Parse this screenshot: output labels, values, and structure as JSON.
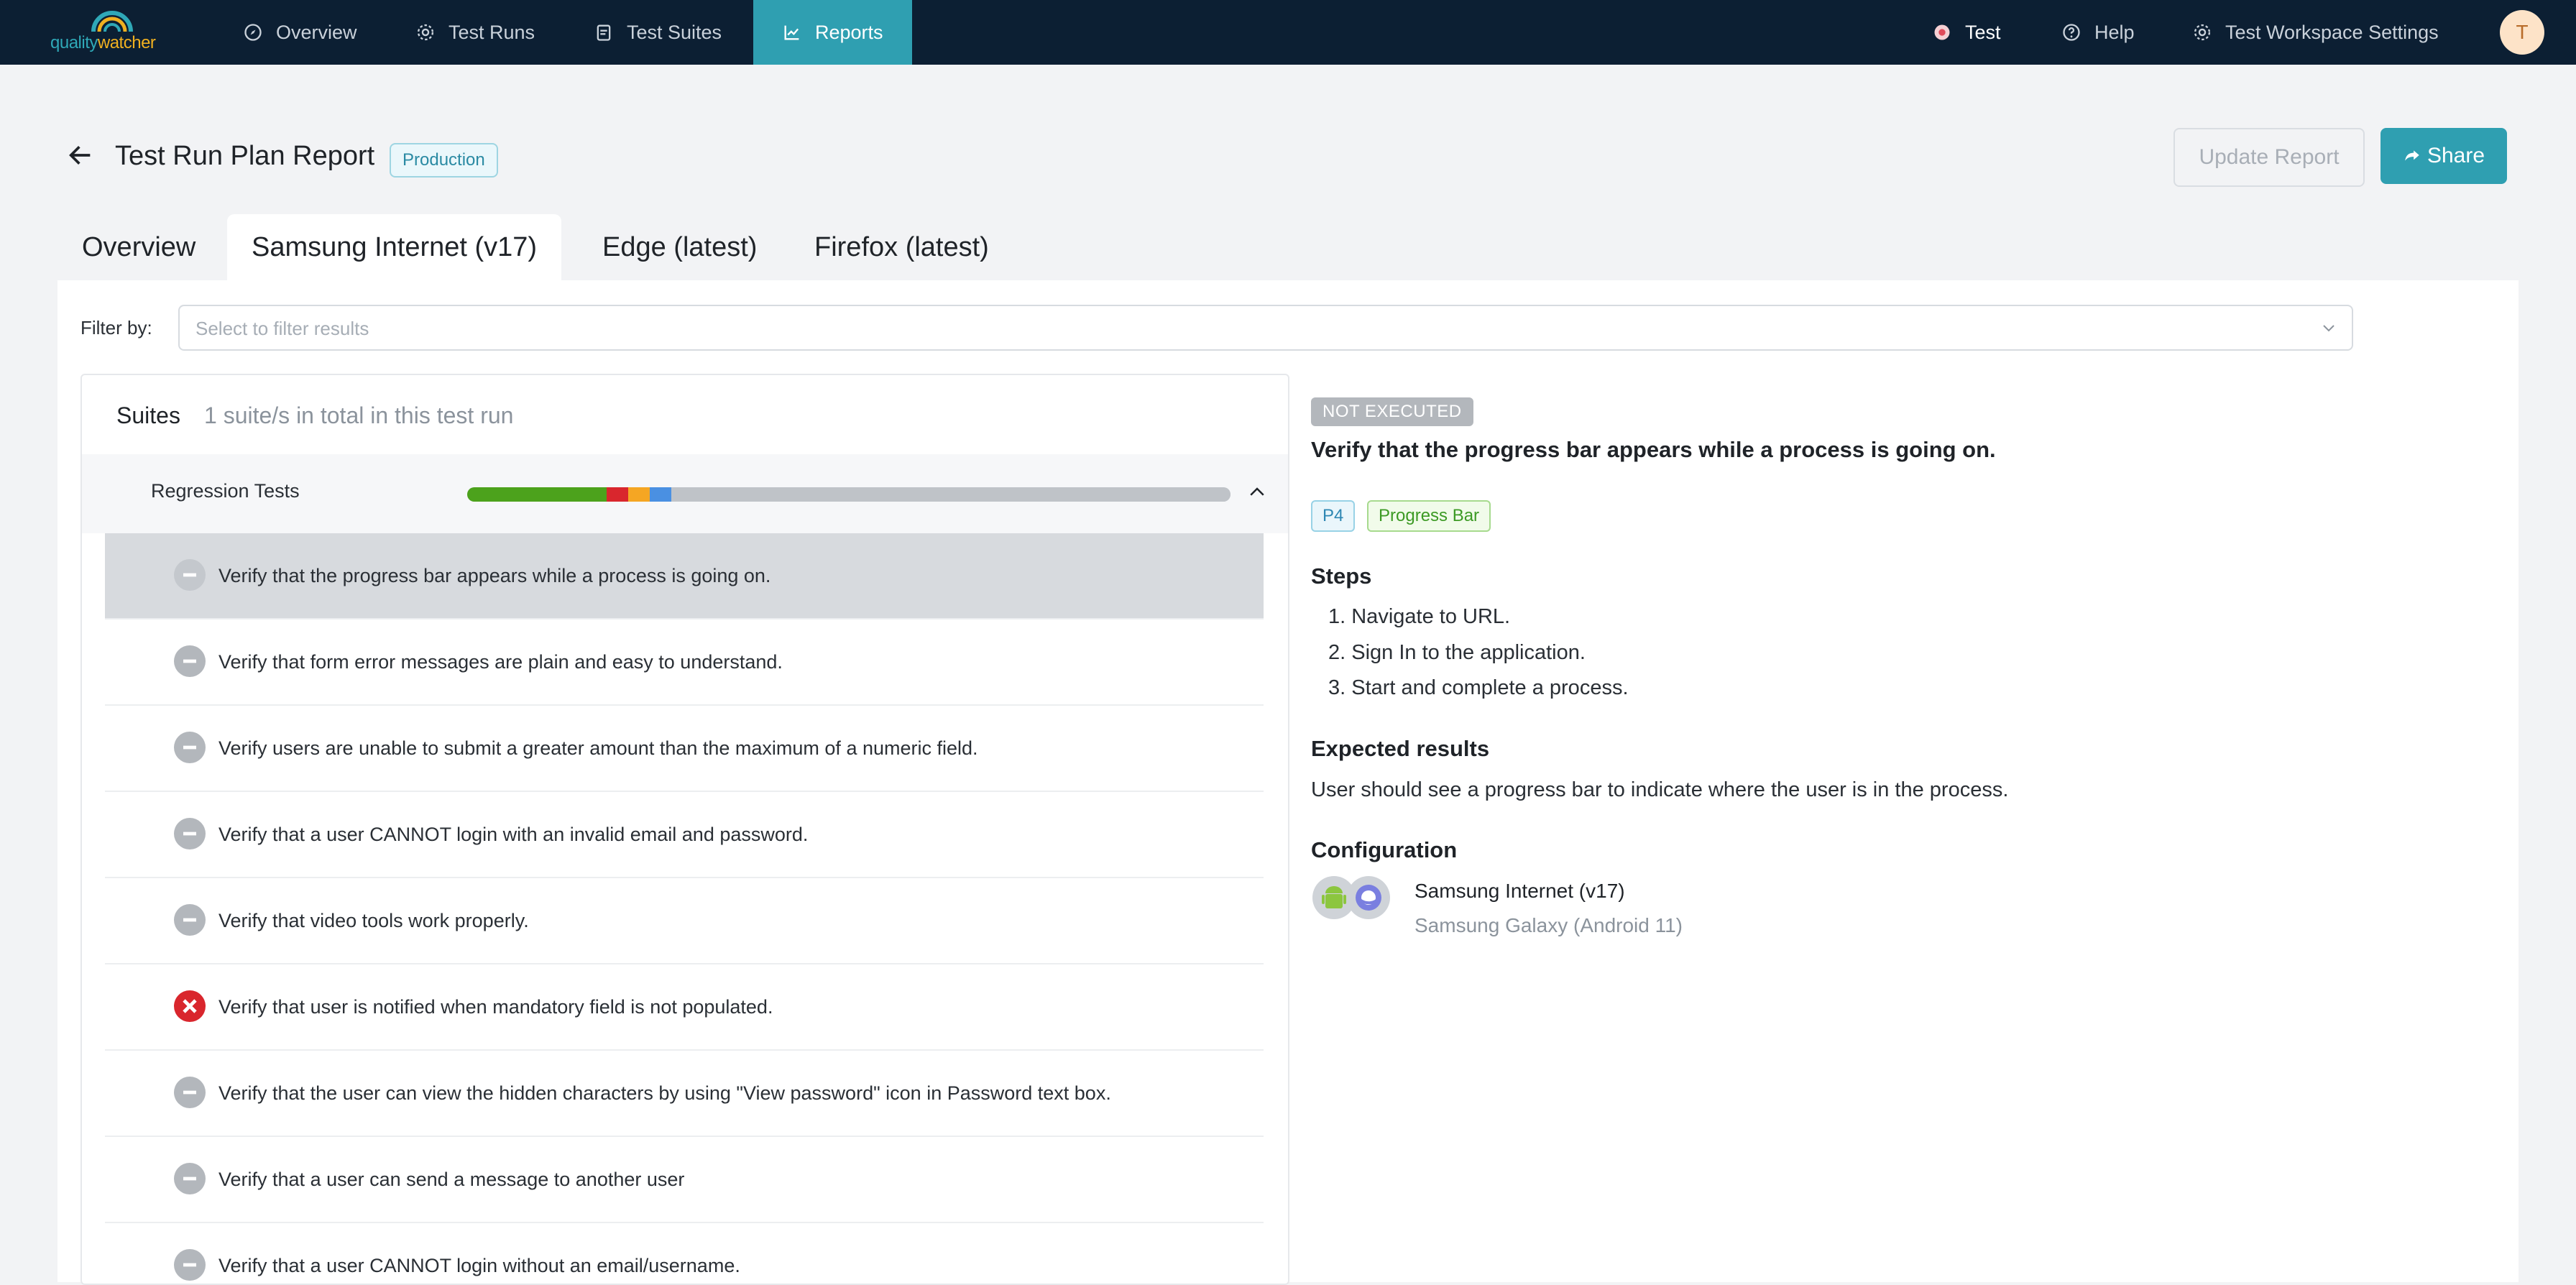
{
  "nav": {
    "logo": {
      "part1": "quality",
      "part2": "watcher"
    },
    "items": [
      {
        "label": "Overview",
        "icon": "compass-icon"
      },
      {
        "label": "Test Runs",
        "icon": "gear-icon"
      },
      {
        "label": "Test Suites",
        "icon": "clipboard-icon"
      },
      {
        "label": "Reports",
        "icon": "chart-line-icon",
        "active": true
      }
    ],
    "right": [
      {
        "label": "Test",
        "icon": "workspace-icon"
      },
      {
        "label": "Help",
        "icon": "help-circle-icon"
      },
      {
        "label": "Test Workspace Settings",
        "icon": "gear-icon"
      }
    ],
    "avatar": "T"
  },
  "header": {
    "title": "Test Run Plan Report",
    "env_badge": "Production",
    "update_button": "Update Report",
    "share_button": "Share"
  },
  "tabs": [
    {
      "label": "Overview",
      "active": false
    },
    {
      "label": "Samsung Internet (v17)",
      "active": true
    },
    {
      "label": "Edge (latest)",
      "active": false
    },
    {
      "label": "Firefox (latest)",
      "active": false
    }
  ],
  "filter": {
    "label": "Filter by:",
    "placeholder": "Select to filter results"
  },
  "suites": {
    "heading": "Suites",
    "subheading": "1 suite/s in total in this test run",
    "suite_name": "Regression Tests",
    "progress_fractions": [
      {
        "status": "passed",
        "fraction": 0.183,
        "color": "#4ca21c"
      },
      {
        "status": "failed",
        "fraction": 0.028,
        "color": "#d9262d"
      },
      {
        "status": "blocked",
        "fraction": 0.028,
        "color": "#f5a623"
      },
      {
        "status": "retest",
        "fraction": 0.028,
        "color": "#4a90e2"
      },
      {
        "status": "not-executed",
        "fraction": 0.733,
        "color": "#bfc3c8"
      }
    ],
    "cases": [
      {
        "text": "Verify that the progress bar appears while a process is going on.",
        "status": "not-executed",
        "selected": true
      },
      {
        "text": "Verify that form error messages are plain and easy to understand.",
        "status": "not-executed"
      },
      {
        "text": "Verify users are unable to submit a greater amount than the maximum of a numeric field.",
        "status": "not-executed"
      },
      {
        "text": "Verify that a user CANNOT login with an invalid email and password.",
        "status": "not-executed"
      },
      {
        "text": "Verify that video tools work properly.",
        "status": "not-executed"
      },
      {
        "text": "Verify that user is notified when mandatory field is not populated.",
        "status": "failed"
      },
      {
        "text": "Verify that the user can view the hidden characters by using \"View password\" icon in Password text box.",
        "status": "not-executed"
      },
      {
        "text": "Verify that a user can send a message to another user",
        "status": "not-executed"
      },
      {
        "text": "Verify that a user CANNOT login without an email/username.",
        "status": "not-executed"
      }
    ]
  },
  "detail": {
    "status": "NOT EXECUTED",
    "title": "Verify that the progress bar appears while a process is going on.",
    "tags": [
      "P4",
      "Progress Bar"
    ],
    "steps_title": "Steps",
    "steps": [
      "1. Navigate to URL.",
      "2. Sign In to the application.",
      "3. Start and complete a process."
    ],
    "expected_title": "Expected results",
    "expected": "User should see a progress bar to indicate where the user is in the process.",
    "config_title": "Configuration",
    "config_name": "Samsung Internet (v17)",
    "config_device": "Samsung Galaxy (Android 11)"
  },
  "colors": {
    "nav_bg": "#0c1f33",
    "accent": "#2f9fb1",
    "failed": "#d9262d",
    "not_executed": "#b3b7bc"
  }
}
